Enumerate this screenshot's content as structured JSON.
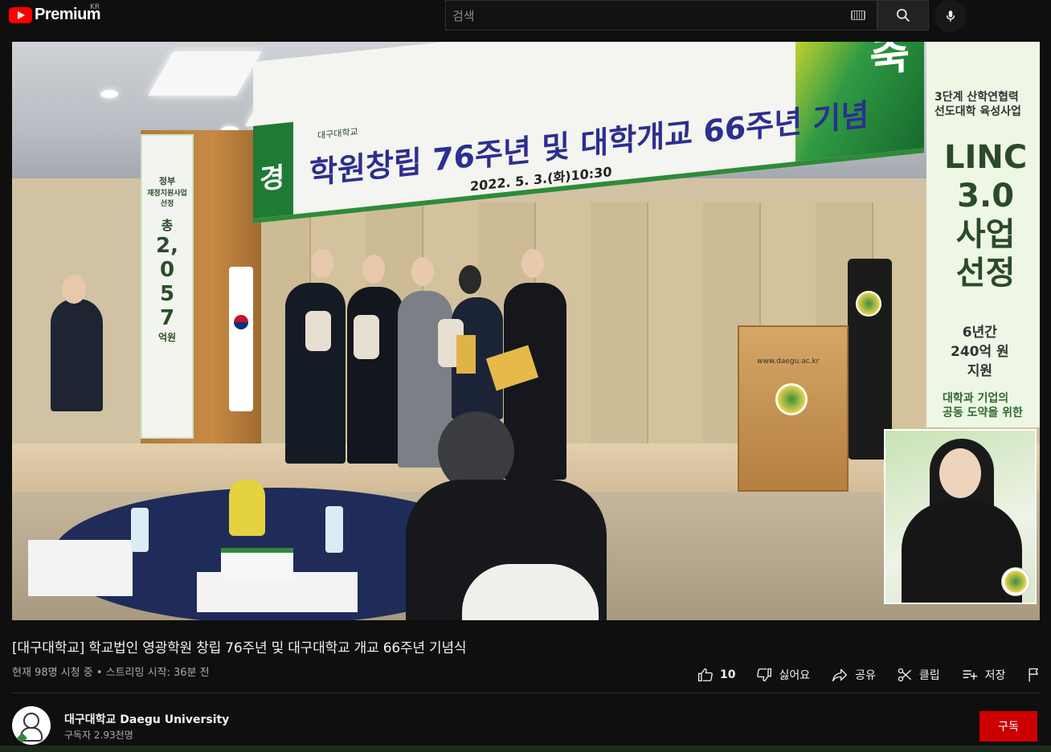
{
  "header": {
    "logo_text": "Premium",
    "country_code": "KR",
    "search_placeholder": "검색"
  },
  "video": {
    "banner_main": "학원창립 76주년 및 대학개교 66주년 기념",
    "banner_left_char": "경",
    "banner_right_char": "축",
    "banner_university": "대구대학교",
    "banner_date": "2022. 5. 3.(화)10:30",
    "left_banner": [
      "정부",
      "재정지원사업",
      "선정",
      "총",
      "2,",
      "0",
      "5",
      "7",
      "억원"
    ],
    "right_banner": {
      "line1": "3단계 산학연협력",
      "line2": "선도대학 육성사업",
      "big": [
        "LINC",
        "3.0",
        "사업",
        "선정"
      ],
      "sub": [
        "6년간",
        "240억 원",
        "지원"
      ],
      "foot1": "대학과 기업의",
      "foot2": "공동 도약을 위한"
    },
    "podium_web": "www.daegu.ac.kr"
  },
  "title": "[대구대학교] 학교법인 영광학원 창립 76주년 및 대구대학교 개교 66주년 기념식",
  "meta": "현재 98명 시청 중 • 스트리밍 시작: 36분 전",
  "actions": {
    "like_count": "10",
    "dislike": "싫어요",
    "share": "공유",
    "clip": "클립",
    "save": "저장"
  },
  "channel": {
    "name": "대구대학교 Daegu University",
    "subscribers": "구독자 2.93천명",
    "subscribe_label": "구독"
  },
  "colors": {
    "background": "#0f0f0f",
    "subscribe": "#cc0000",
    "youtube_red": "#ff0000"
  }
}
